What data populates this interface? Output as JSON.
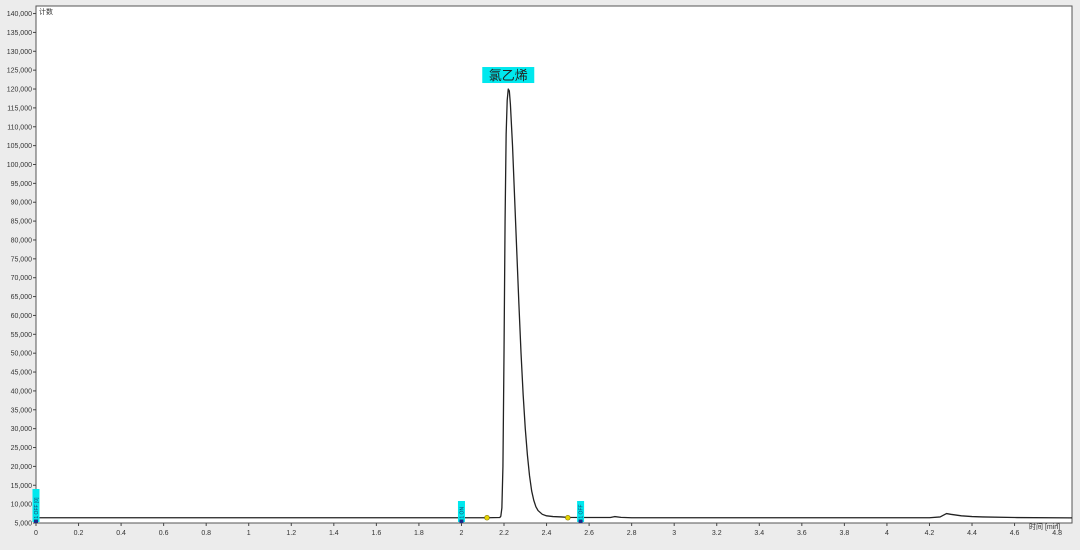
{
  "chart_data": {
    "type": "line",
    "title": "",
    "xlabel": "",
    "ylabel": "",
    "y_unit_label": "计数",
    "x_unit_label": "时间 [min]",
    "xlim": [
      0,
      4.87
    ],
    "ylim": [
      5000,
      142000
    ],
    "x_ticks": [
      0,
      0.2,
      0.4,
      0.6,
      0.8,
      1,
      1.2,
      1.4,
      1.6,
      1.8,
      2,
      2.2,
      2.4,
      2.6,
      2.8,
      3,
      3.2,
      3.4,
      3.6,
      3.8,
      4,
      4.2,
      4.4,
      4.6,
      4.8
    ],
    "y_ticks": [
      5000,
      10000,
      15000,
      20000,
      25000,
      30000,
      35000,
      40000,
      45000,
      50000,
      55000,
      60000,
      65000,
      70000,
      75000,
      80000,
      85000,
      90000,
      95000,
      100000,
      105000,
      110000,
      115000,
      120000,
      125000,
      130000,
      135000,
      140000
    ],
    "y_tick_labels": [
      "5,000",
      "10,000",
      "15,000",
      "20,000",
      "25,000",
      "30,000",
      "35,000",
      "40,000",
      "45,000",
      "50,000",
      "55,000",
      "60,000",
      "65,000",
      "70,000",
      "75,000",
      "80,000",
      "85,000",
      "90,000",
      "95,000",
      "100,000",
      "105,000",
      "110,000",
      "115,000",
      "120,000",
      "125,000",
      "130,000",
      "135,000",
      "140,000"
    ],
    "x_tick_labels": [
      "0",
      "0.2",
      "0.4",
      "0.6",
      "0.8",
      "1",
      "1.2",
      "1.4",
      "1.6",
      "1.8",
      "2",
      "2.2",
      "2.4",
      "2.6",
      "2.8",
      "3",
      "3.2",
      "3.4",
      "3.6",
      "3.8",
      "4",
      "4.2",
      "4.4",
      "4.6",
      "4.8"
    ],
    "grid": false,
    "series": [
      {
        "color": "#222222",
        "x": [
          0,
          2.0,
          2.12,
          2.18,
          2.185,
          2.19,
          2.195,
          2.2,
          2.205,
          2.21,
          2.215,
          2.22,
          2.225,
          2.23,
          2.24,
          2.25,
          2.26,
          2.27,
          2.28,
          2.29,
          2.3,
          2.31,
          2.32,
          2.33,
          2.34,
          2.35,
          2.36,
          2.38,
          2.4,
          2.43,
          2.47,
          2.5,
          2.56,
          2.7,
          2.72,
          2.75,
          2.8,
          3.0,
          4.2,
          4.25,
          4.28,
          4.3,
          4.35,
          4.4,
          4.45,
          4.6,
          4.87
        ],
        "y": [
          6400,
          6400,
          6400,
          6450,
          6800,
          9000,
          20000,
          50000,
          85000,
          108000,
          117000,
          120000,
          119500,
          116000,
          105000,
          91000,
          77000,
          63000,
          50000,
          39000,
          30000,
          23000,
          17500,
          13500,
          11000,
          9300,
          8300,
          7300,
          6900,
          6700,
          6600,
          6500,
          6450,
          6450,
          6700,
          6500,
          6400,
          6400,
          6400,
          6600,
          7500,
          7300,
          6900,
          6700,
          6600,
          6450,
          6350
        ]
      }
    ],
    "annotations": [
      {
        "text": "氯乙烯",
        "x": 2.22,
        "y": 120000,
        "type": "peak-label",
        "color": "#00e8ee"
      },
      {
        "text": "I1 OFF [0]",
        "x": 0.0,
        "type": "event-marker",
        "color": "#00e8ee"
      },
      {
        "text": "I1 ON",
        "x": 2.0,
        "type": "event-marker",
        "color": "#00e8ee"
      },
      {
        "text": "I1 OFF",
        "x": 2.56,
        "type": "event-marker",
        "color": "#00e8ee"
      }
    ],
    "baseline_markers": [
      {
        "x": 2.12,
        "color": "#e6d400"
      },
      {
        "x": 2.5,
        "color": "#e6d400"
      }
    ]
  }
}
